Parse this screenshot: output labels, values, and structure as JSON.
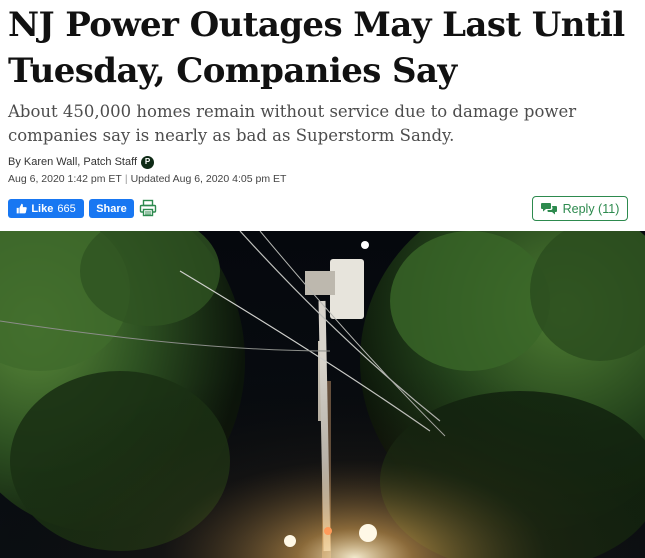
{
  "article": {
    "headline": "NJ Power Outages May Last Until Tuesday, Companies Say",
    "subheadline": "About 450,000 homes remain without service due to damage power companies say is nearly as bad as Superstorm Sandy.",
    "byline": "By Karen Wall, Patch Staff",
    "patch_badge": "P",
    "published": "Aug 6, 2020 1:42 pm ET",
    "separator": "|",
    "updated": "Updated Aug 6, 2020 4:05 pm ET"
  },
  "actions": {
    "like_label": "Like",
    "like_count": "665",
    "share_label": "Share",
    "reply_label": "Reply (11)"
  },
  "colors": {
    "facebook_blue": "#1877f2",
    "reply_green": "#2d8a4e",
    "patch_badge": "#0f2a16"
  },
  "icons": {
    "like": "thumbs-up-icon",
    "print": "printer-icon",
    "reply": "speech-bubbles-icon"
  }
}
